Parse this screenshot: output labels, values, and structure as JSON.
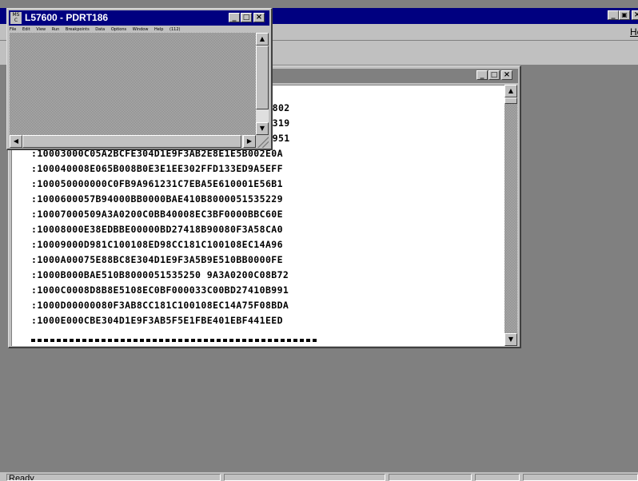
{
  "main_window": {
    "menu_help": "Help",
    "status_text": "Ready"
  },
  "hex_window": {
    "partial_lines": [
      "0B802",
      "FE319",
      "FB951"
    ],
    "lines": [
      ":10003000C05A2BCFE304D1E9F3AB2E8E1E5B002E0A",
      ":100040008E065B008B0E3E1EE302FFD133ED9A5EFF",
      ":100050000000C0FB9A961231C7EBA5E610001E56B1",
      ":1000600057B94000BB0000BAE410B8000051535229",
      ":10007000509A3A0200C0BB40008EC3BF0000BBC60E",
      ":10008000E38EDBBE00000BD27418B90080F3A58CA0",
      ":10009000D981C100108ED98CC181C100108EC14A96",
      ":1000A00075E88BC8E304D1E9F3A5B9E510BB0000FE",
      ":1000B000BAE510B8000051535250 9A3A0200C08B72",
      ":1000C0008D8B8E5108EC0BF000033C00BD27410B991",
      ":1000D00000080F3AB8CC181C100108EC14A75F08BDA",
      ":1000E000CBE304D1E9F3AB5F5E1FBE401EBF441EED"
    ]
  },
  "mini_window": {
    "logo_text": "MS\nC",
    "title": "L57600 - PDRT186",
    "menu": [
      "File",
      "Edit",
      "View",
      "Run",
      "Breakpoints",
      "Data",
      "Options",
      "Window",
      "Help",
      "(112)"
    ]
  },
  "icons": {
    "minimize": "minimize-icon",
    "maximize": "maximize-icon",
    "close": "close-icon",
    "restore": "restore-icon",
    "scroll_up": "arrow-up-icon",
    "scroll_down": "arrow-down-icon",
    "scroll_left": "arrow-left-icon",
    "scroll_right": "arrow-right-icon"
  }
}
